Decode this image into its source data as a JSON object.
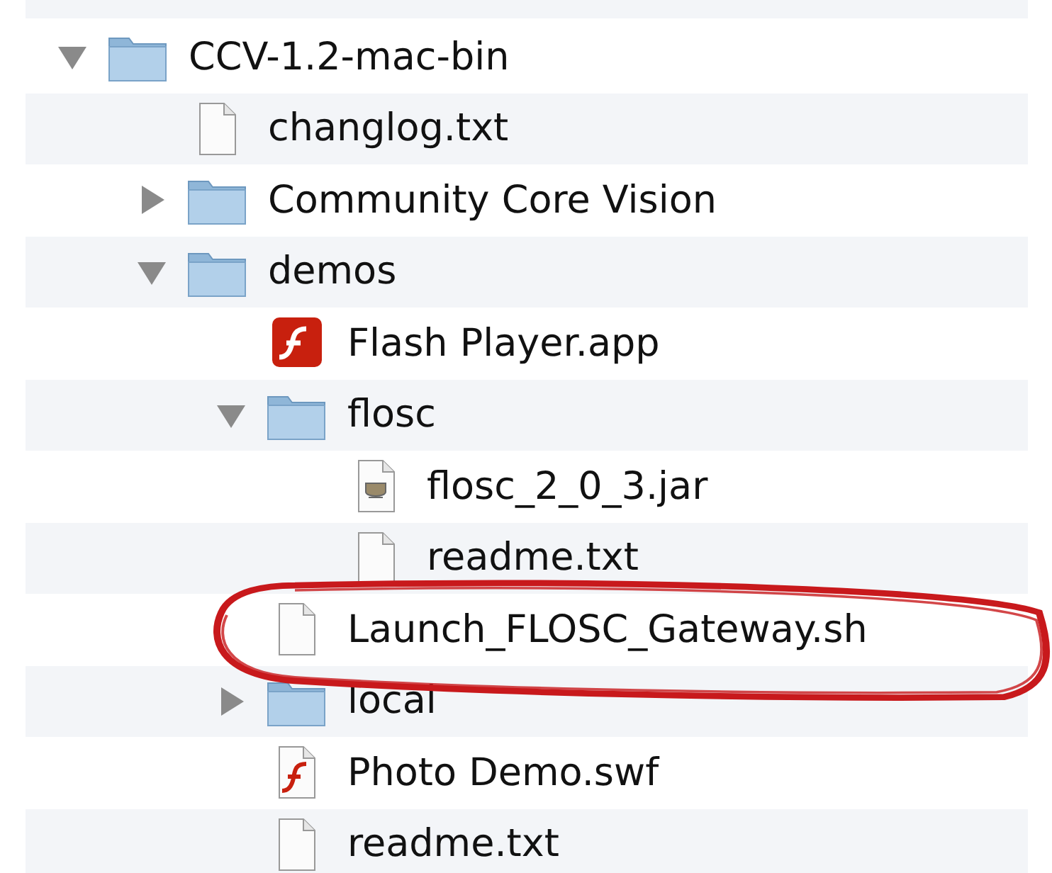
{
  "files": [
    {
      "name": "CCV-1.2-mac-bin",
      "kind": "folder",
      "expanded": true,
      "children": [
        {
          "name": "changlog.txt",
          "kind": "text"
        },
        {
          "name": "Community Core Vision",
          "kind": "folder",
          "expanded": false
        },
        {
          "name": "demos",
          "kind": "folder",
          "expanded": true,
          "children": [
            {
              "name": "Flash Player.app",
              "kind": "app"
            },
            {
              "name": "flosc",
              "kind": "folder",
              "expanded": true,
              "children": [
                {
                  "name": "flosc_2_0_3.jar",
                  "kind": "jar"
                },
                {
                  "name": "readme.txt",
                  "kind": "text"
                }
              ]
            },
            {
              "name": "Launch_FLOSC_Gateway.sh",
              "kind": "text"
            },
            {
              "name": "local",
              "kind": "folder",
              "expanded": false
            },
            {
              "name": "Photo Demo.swf",
              "kind": "swf"
            },
            {
              "name": "readme.txt",
              "kind": "text"
            }
          ]
        }
      ]
    }
  ],
  "annotation": {
    "kind": "ellipse"
  }
}
